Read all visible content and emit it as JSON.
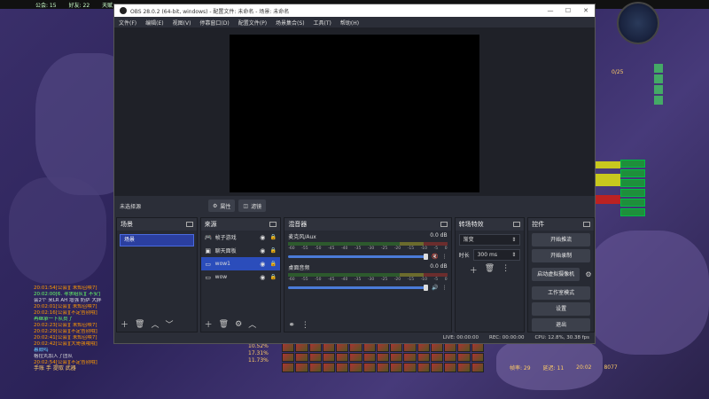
{
  "game": {
    "topbar": [
      "公会: 15",
      "好友: 22",
      "天赋"
    ],
    "minimap_label": "0/25",
    "green_bars": [
      "",
      "",
      "",
      "",
      "",
      ""
    ],
    "chat": [
      {
        "text": "20:01:54[公会][ 未知召唤7]",
        "cls": "o"
      },
      {
        "text": "20:02:00[6. 寻求组队][ 不安]",
        "cls": "g"
      },
      {
        "text": "会2个 来LR AH 增强 奶萨 大胖",
        "cls": ""
      },
      {
        "text": "20:02:01[公会][ 未知召唤7]",
        "cls": "o"
      },
      {
        "text": "20:02:16[公会][不定告别哦]",
        "cls": "o"
      },
      {
        "text": "再继承一下队员了",
        "cls": "g"
      },
      {
        "text": "20:02:23[公会][ 未知召唤7]",
        "cls": "o"
      },
      {
        "text": "20:02:29[公会][不定告别哦]",
        "cls": "o"
      },
      {
        "text": "20:02:41[公会][ 未知召唤7]",
        "cls": "o"
      },
      {
        "text": "20:02:42[公会][大哥强哦哦]",
        "cls": "o"
      },
      {
        "text": "暮鼓鸣",
        "cls": "b"
      },
      {
        "text": "格拉丸加入了团队",
        "cls": ""
      },
      {
        "text": "20:02:54[公会][不定告别哦]",
        "cls": "o"
      }
    ],
    "stats": [
      "10.52%",
      "17.31%",
      "11.73%"
    ],
    "bottom_left": "手账 手  提取 武器",
    "bottom_bar": [
      "帧率: 29",
      "延迟: 11",
      "20:02",
      "8077"
    ]
  },
  "obs": {
    "title": "OBS 28.0.2 (64-bit, windows) - 配置文件: 未命名 - 场景: 未命名",
    "menu": [
      "文件(F)",
      "编辑(E)",
      "视图(V)",
      "停靠窗口(D)",
      "配置文件(P)",
      "场景集合(S)",
      "工具(T)",
      "帮助(H)"
    ],
    "source_toolbar": {
      "no_source": "未选择源",
      "properties": "属性",
      "filters": "滤镜"
    },
    "scenes": {
      "title": "场景",
      "items": [
        "场景"
      ]
    },
    "sources": {
      "title": "来源",
      "items": [
        {
          "name": "帧子游戏",
          "selected": false,
          "icon": "gamepad-icon"
        },
        {
          "name": "聊天面板",
          "selected": false,
          "icon": "image-icon"
        },
        {
          "name": "wow1",
          "selected": true,
          "icon": "window-icon"
        },
        {
          "name": "wow",
          "selected": false,
          "icon": "window-icon"
        }
      ]
    },
    "mixer": {
      "title": "混音器",
      "channels": [
        {
          "name": "麦克风/Aux",
          "db": "0.0 dB"
        },
        {
          "name": "桌面音频",
          "db": "0.0 dB"
        }
      ],
      "scale": [
        "-60",
        "-55",
        "-50",
        "-45",
        "-40",
        "-35",
        "-30",
        "-25",
        "-20",
        "-15",
        "-10",
        "-5",
        "0"
      ]
    },
    "transitions": {
      "title": "转场特效",
      "selected": "渐变",
      "duration_label": "时长",
      "duration": "300 ms"
    },
    "controls": {
      "title": "控件",
      "buttons": [
        "开始推流",
        "开始录制",
        "启动虚拟摄像机",
        "工作室模式",
        "设置",
        "退出"
      ]
    },
    "status": {
      "live": "LIVE: 00:00:00",
      "rec": "REC: 00:00:00",
      "cpu": "CPU: 12.8%, 30.38 fps"
    }
  }
}
